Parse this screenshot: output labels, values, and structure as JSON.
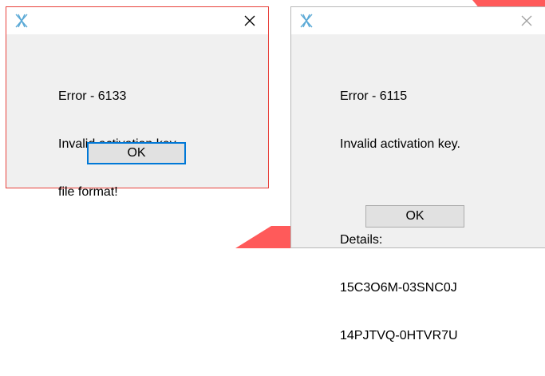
{
  "colors": {
    "accent_red": "#ff5a5a",
    "active_border": "#e8413b",
    "focus_blue": "#0078d7",
    "icon_blue": "#5aa9d6"
  },
  "dialogs": [
    {
      "icon": "app-logo-icon",
      "close_icon": "close-icon",
      "message_lines": [
        "Error - 6133",
        "Invalid activation.key",
        "file format!"
      ],
      "ok_label": "OK",
      "active": true
    },
    {
      "icon": "app-logo-icon",
      "close_icon": "close-icon",
      "message_lines": [
        "Error - 6115",
        "Invalid activation key.",
        "",
        "Details:",
        "15C3O6M-03SNC0J",
        "14PJTVQ-0HTVR7U"
      ],
      "ok_label": "OK",
      "active": false
    }
  ]
}
